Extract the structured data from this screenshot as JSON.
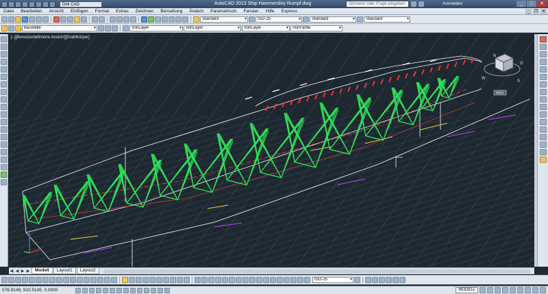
{
  "window": {
    "title": "AutoCAD 2013   Ship Hammersley Rumpf.dwg",
    "workspace": "Dirk CAD",
    "search_placeholder": "Stichwort oder Frage eingeben",
    "login_label": "Anmelden",
    "controls": [
      "_",
      "□",
      "✕"
    ]
  },
  "menu": {
    "items": [
      "Datei",
      "Bearbeiten",
      "Ansicht",
      "Einfügen",
      "Format",
      "Extras",
      "Zeichnen",
      "Bemaßung",
      "Ändern",
      "Parametrisch",
      "Fenster",
      "Hilfe",
      "Express"
    ]
  },
  "toolbar1": {
    "text_style": "Standard",
    "dim_style": "ISO-25",
    "table_style": "Standard",
    "multileader_style": "Standard"
  },
  "toolbar2": {
    "layer": "Baustelle",
    "color": "VonLayer",
    "linetype": "VonLayer",
    "lineweight": "VonLayer",
    "plotstyle": "VonFarbe"
  },
  "viewport": {
    "label": "[–][Benutzerdefinierte Ansicht][Drahtkörper]",
    "viewcube_label": "VORNE",
    "wcs_label": "WKS",
    "compass": [
      "N",
      "S",
      "W",
      "O"
    ]
  },
  "tabs": {
    "items": [
      "Modell",
      "Layout1",
      "Layout2"
    ],
    "nav": [
      "◀",
      "◀",
      "▶",
      "▶"
    ]
  },
  "status_toolbar": {
    "dim_style": "ISO-25"
  },
  "statusbar": {
    "coords": "576.9149, 910.5145, 0.0000",
    "model": "MODELL"
  },
  "colors": {
    "background": "#1e2830",
    "grid": "#3a4652",
    "frames": "#2fe05a",
    "deck_markers": "#ff3030",
    "outline": "#ffffff",
    "accent_yellow": "#e8d44a",
    "accent_magenta": "#c040ff",
    "accent_blue": "#3a6cff"
  }
}
